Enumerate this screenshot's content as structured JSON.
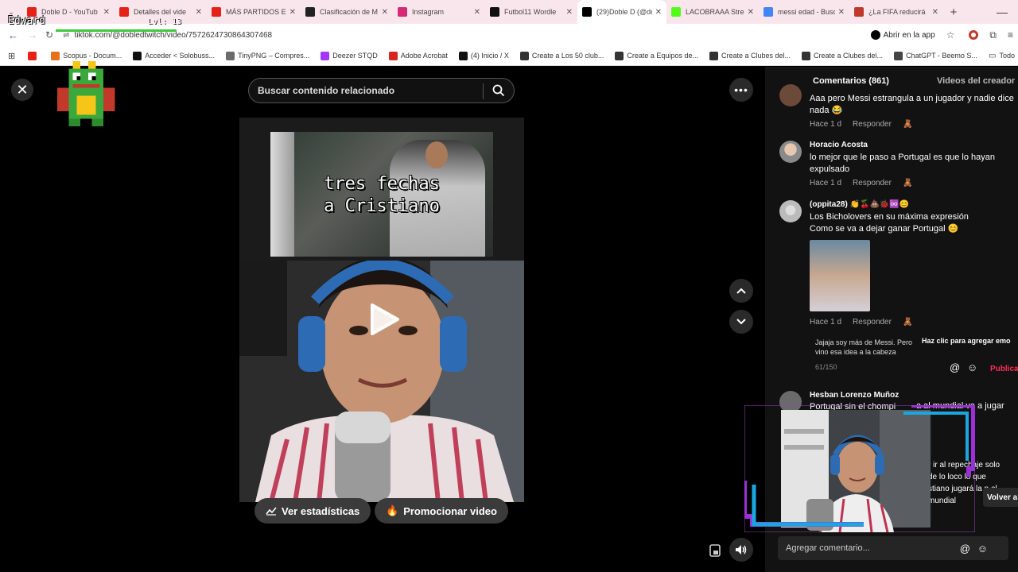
{
  "browser": {
    "tabs": [
      {
        "title": "Doble D - YouTub",
        "color": "#e62117",
        "icon": "youtube-icon"
      },
      {
        "title": "Detalles del vide",
        "color": "#e62117",
        "icon": "youtube-icon"
      },
      {
        "title": "MÁS PARTIDOS E",
        "color": "#e62117",
        "icon": "youtube-icon"
      },
      {
        "title": "Clasificación de M",
        "color": "#222222",
        "icon": "c-icon"
      },
      {
        "title": "Instagram",
        "color": "#d62976",
        "icon": "instagram-icon"
      },
      {
        "title": "Futbol11 Wordle",
        "color": "#111111",
        "icon": "ball-icon"
      },
      {
        "title": "(29)Doble D (@do",
        "color": "#000000",
        "icon": "tiktok-icon",
        "active": true
      },
      {
        "title": "LACOBRAAA Stre",
        "color": "#53fc18",
        "icon": "kick-icon"
      },
      {
        "title": "messi edad - Busc",
        "color": "#4285f4",
        "icon": "google-icon"
      },
      {
        "title": "¿La FIFA reducirá",
        "color": "#c0392b",
        "icon": "news-icon"
      }
    ],
    "new_tab": "+",
    "url": "tiktok.com/@dobledtwitch/video/7572624730864307468",
    "open_in_app": "Abrir en la app",
    "bookmarks": [
      {
        "label": "",
        "color": "#e62117"
      },
      {
        "label": "Scopus - Docum...",
        "color": "#e9711c"
      },
      {
        "label": "Acceder < Solobuss...",
        "color": "#111111"
      },
      {
        "label": "TinyPNG – Compres...",
        "color": "#6b6b6b"
      },
      {
        "label": "Deezer STQD",
        "color": "#a238ff"
      },
      {
        "label": "Adobe Acrobat",
        "color": "#d9261c"
      },
      {
        "label": "(4) Inicio / X",
        "color": "#111111"
      },
      {
        "label": "Create a Los 50 club...",
        "color": "#333333"
      },
      {
        "label": "Create a Equipos de...",
        "color": "#333333"
      },
      {
        "label": "Create a Clubes del...",
        "color": "#333333"
      },
      {
        "label": "Create a Clubes del...",
        "color": "#333333"
      },
      {
        "label": "ChatGPT - Beemo S...",
        "color": "#444444"
      }
    ],
    "all_bookmarks": "Todo"
  },
  "overlay": {
    "streamer": "Edward",
    "level": "Lvl: 13"
  },
  "video": {
    "search_placeholder": "Buscar contenido relacionado",
    "thumb_line1": "tres fechas",
    "thumb_line2": "a Cristiano",
    "stats_button": "Ver estadísticas",
    "promote_button": "Promocionar video"
  },
  "panel": {
    "tab_comments": "Comentarios (861)",
    "tab_creator": "Videos del creador",
    "comments": [
      {
        "name": "",
        "text": "Aaa pero Messi estrangula a un jugador y nadie dice nada 😂",
        "time": "Hace 1 d",
        "reply": "Responder"
      },
      {
        "name": "Horacio Acosta",
        "text": "lo mejor que le paso a Portugal es que lo hayan expulsado",
        "time": "Hace 1 d",
        "reply": "Responder"
      },
      {
        "name": "(oppita28) 👏🍒💩🐞♾️😊",
        "text": "Los Bicholovers en su máxima expresión Como se va a dejar ganar Portugal 😊",
        "time": "Hace 1 d",
        "reply": "Responder"
      },
      {
        "name": "Hesban Lorenzo Muñoz",
        "text": "Portugal sin el chompi",
        "text_right": "a al mundial va a jugar",
        "time": "",
        "reply": ""
      }
    ],
    "reply_draft": "Jajaja soy más de Messi. Pero vino esa idea a la cabeza",
    "reply_draft_suffix": "Pe",
    "char_count": "61/150",
    "emoji_tooltip": "Haz clic para agregar emo",
    "publish": "Publica",
    "webcam_side_text": "r ir al repechaje solo de lo loco lo que stiano jugará la n el mundial",
    "back_btn": "Volver a",
    "add_comment_placeholder": "Agregar comentario..."
  }
}
